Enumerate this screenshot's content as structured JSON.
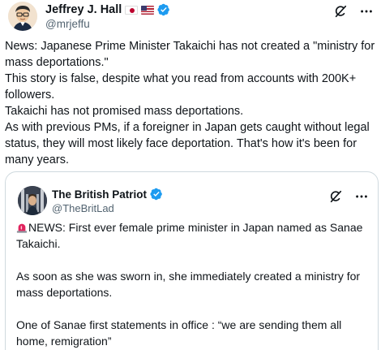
{
  "tweet": {
    "author": {
      "display_name": "Jeffrey J. Hall",
      "handle": "@mrjeffu",
      "flags": [
        "japan-flag-icon",
        "us-flag-icon"
      ],
      "verified": true
    },
    "body_lines": [
      "News:  Japanese Prime Minister Takaichi has not created a \"ministry for mass deportations.\"",
      "This story is false, despite what you read from accounts with 200K+ followers.",
      "Takaichi has not promised mass deportations.",
      "As with previous PMs, if a foreigner in Japan gets caught without legal status, they will most likely face deportation. That's how it's been for many years."
    ]
  },
  "quote": {
    "author": {
      "display_name": "The British Patriot",
      "handle": "@TheBritLad",
      "verified": true
    },
    "paragraphs": [
      "NEWS: First ever female prime minister in Japan named as Sanae Takaichi.",
      "As soon as she was sworn in, she immediately created a ministry for mass deportations.",
      "One of Sanae first statements in office : “we are sending them all home, remigration”"
    ]
  },
  "colors": {
    "text": "#0f1419",
    "secondary": "#536471",
    "verified": "#1d9bf0",
    "border": "#cfd9de"
  }
}
